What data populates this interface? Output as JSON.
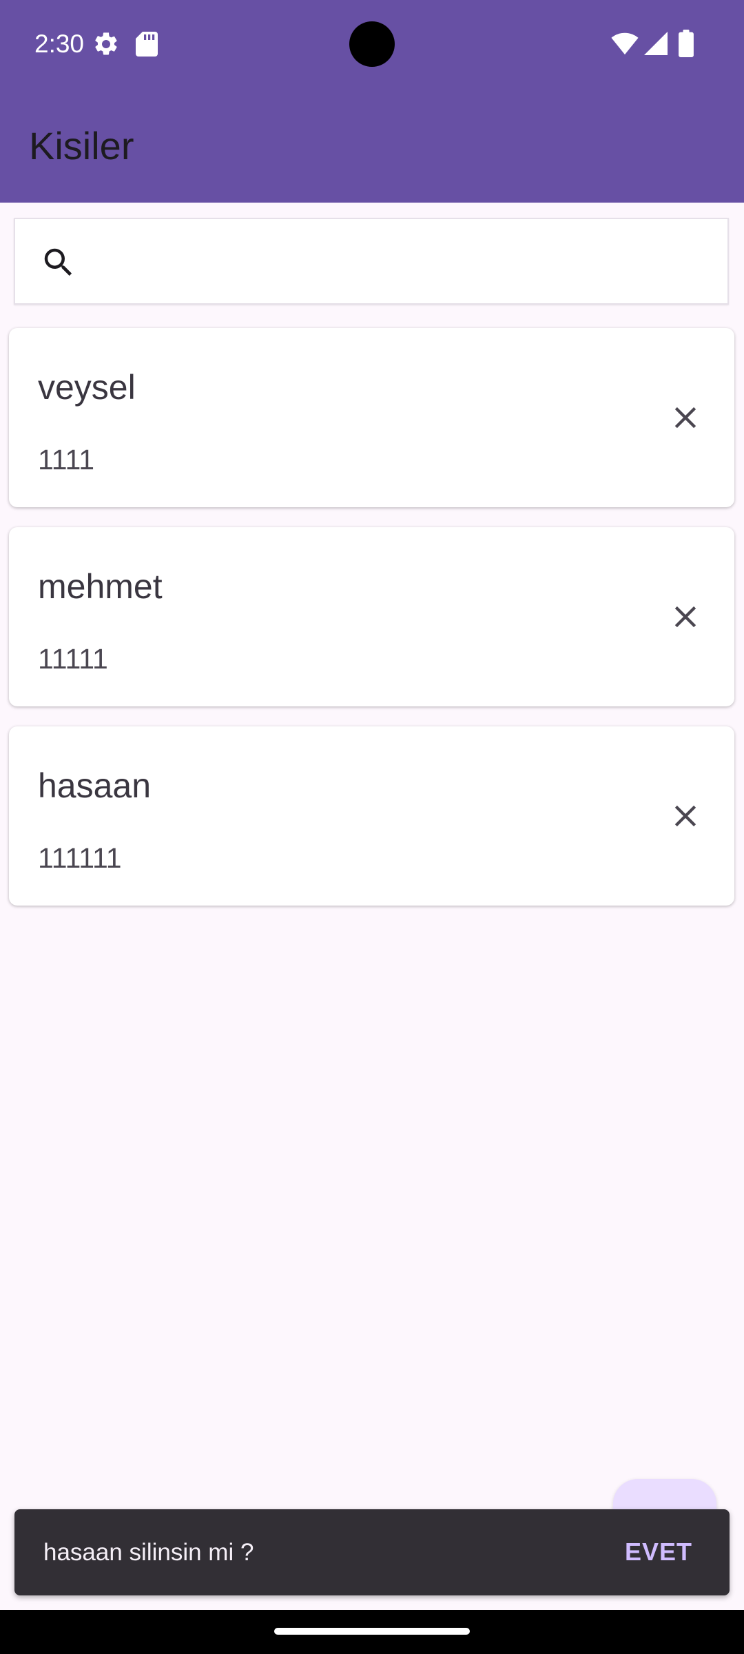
{
  "status_bar": {
    "time": "2:30",
    "icons": [
      "gear-icon",
      "sd-card-icon",
      "wifi-icon",
      "signal-icon",
      "battery-icon"
    ]
  },
  "app_bar": {
    "title": "Kisiler",
    "color": "#6750A4"
  },
  "search": {
    "value": "",
    "placeholder": "",
    "icon": "search-icon"
  },
  "contacts": [
    {
      "name": "veysel",
      "phone": "1111",
      "action_icon": "close-icon"
    },
    {
      "name": "mehmet",
      "phone": "11111",
      "action_icon": "close-icon"
    },
    {
      "name": "hasaan",
      "phone": "111111",
      "action_icon": "close-icon"
    }
  ],
  "snackbar": {
    "message": "hasaan silinsin mi ?",
    "action_label": "EVET",
    "action_color": "#D0BCFF"
  },
  "colors": {
    "background": "#FDF7FD",
    "fab": "#EADDFF",
    "snackbar": "#322F35"
  }
}
